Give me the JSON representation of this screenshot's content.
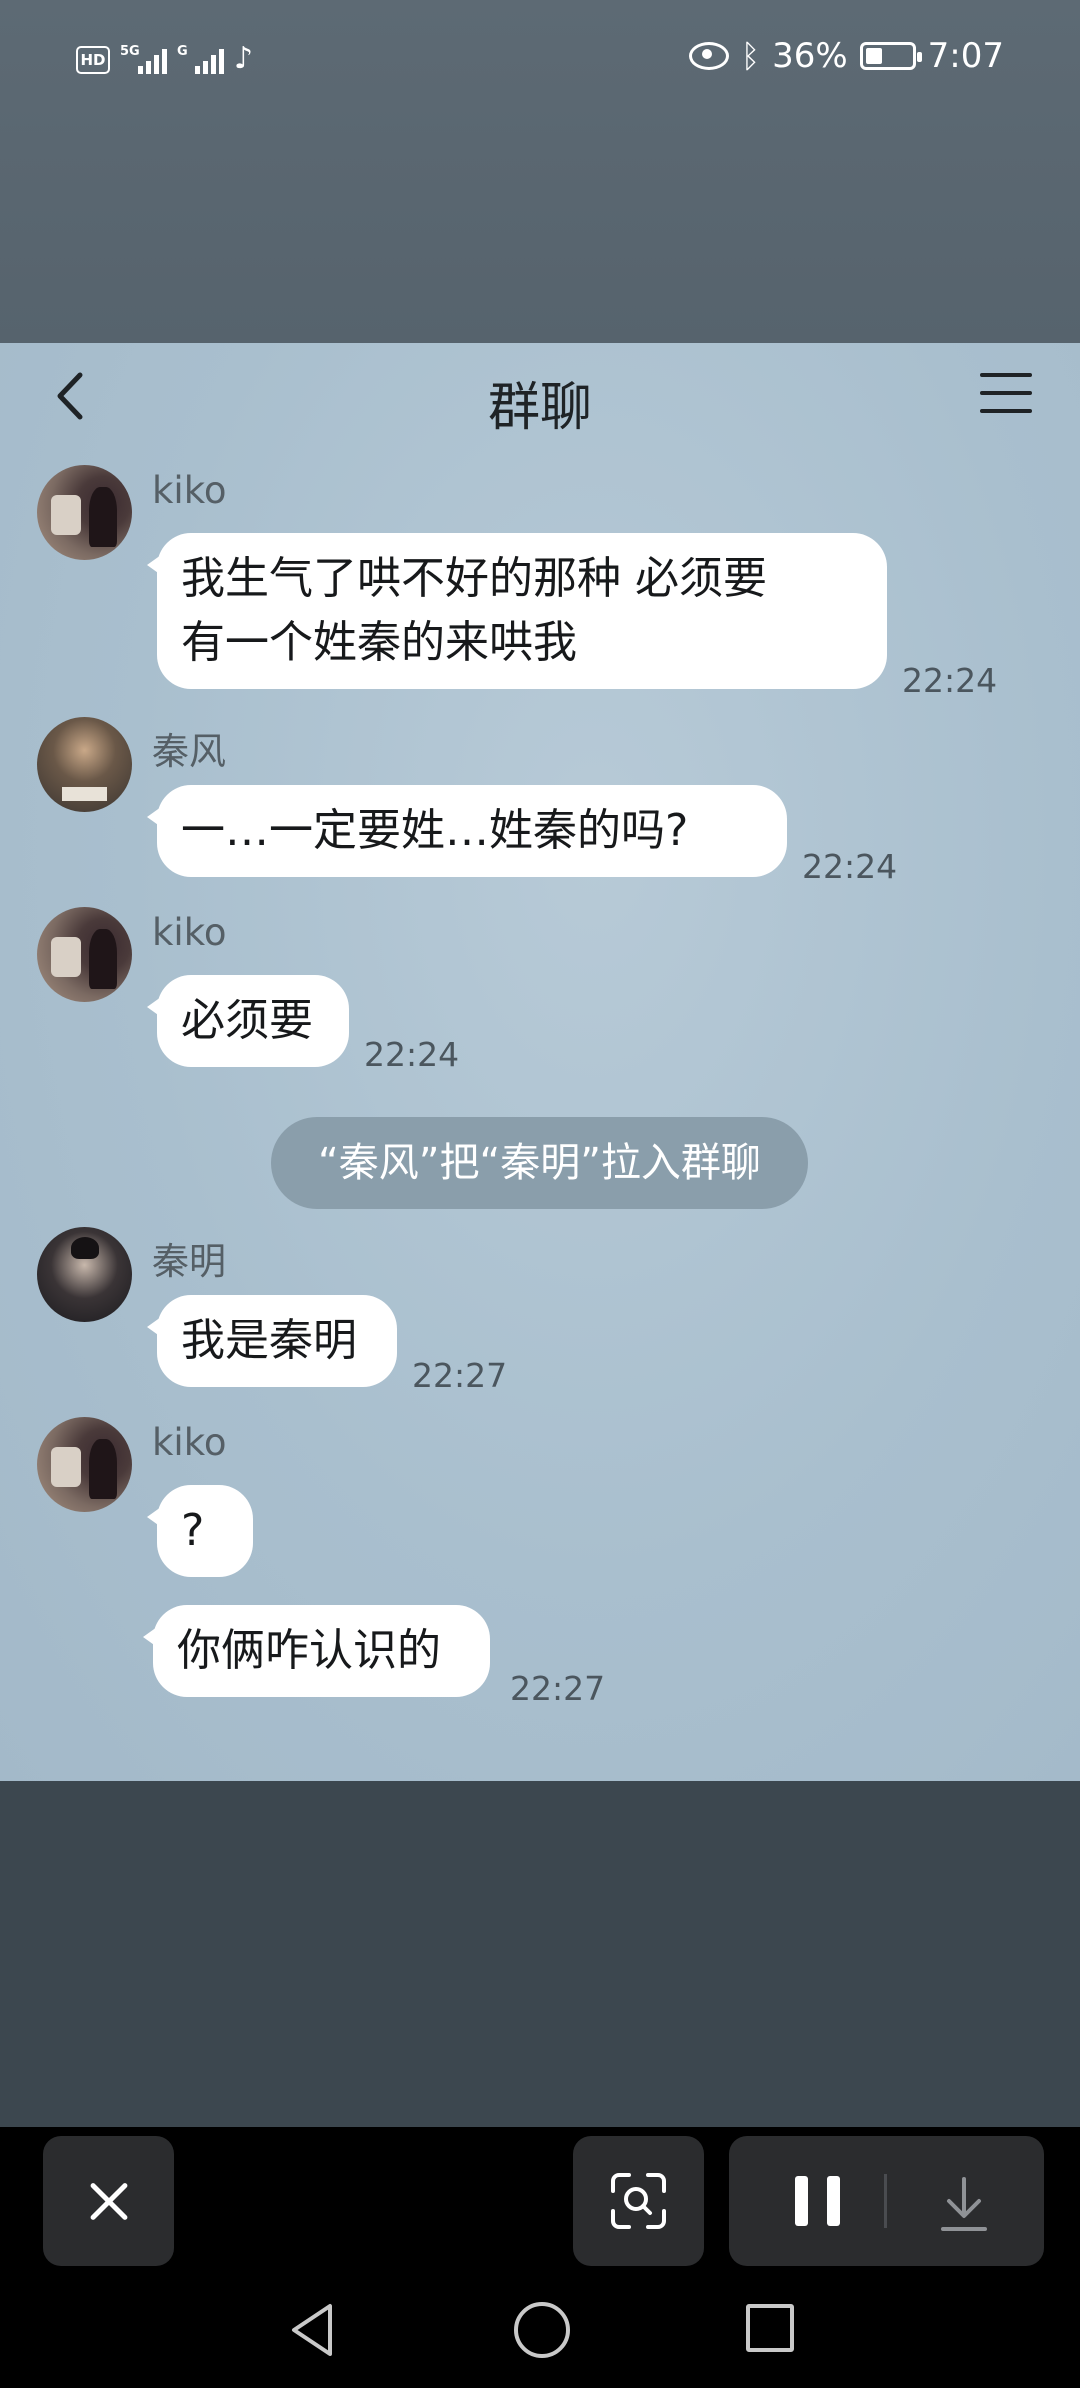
{
  "status_bar": {
    "hd_label": "HD",
    "network1": "5G",
    "network2": "G",
    "battery_percent": "36%",
    "battery_level": 0.36,
    "time": "7:07",
    "icons": [
      "hd-icon",
      "signal-icon",
      "tiktok-icon",
      "eye-icon",
      "bluetooth-icon",
      "battery-icon"
    ]
  },
  "chat": {
    "title": "群聊",
    "back_icon": "chevron-left-icon",
    "menu_icon": "menu-icon",
    "messages": [
      {
        "sender": "kiko",
        "text": "我生气了哄不好的那种 必须要\n有一个姓秦的来哄我",
        "time": "22:24"
      },
      {
        "sender": "秦风",
        "text": "一…一定要姓…姓秦的吗?",
        "time": "22:24"
      },
      {
        "sender": "kiko",
        "text": "必须要",
        "time": "22:24"
      },
      {
        "sender": "秦明",
        "text": "我是秦明",
        "time": "22:27"
      },
      {
        "sender": "kiko",
        "text": "?",
        "time": ""
      },
      {
        "sender": "kiko",
        "text": "你俩咋认识的",
        "time": "22:27"
      }
    ],
    "system_notice": "“秦风”把“秦明”拉入群聊"
  },
  "toolbar": {
    "buttons": [
      "close-icon",
      "scan-icon",
      "pause-icon",
      "download-icon"
    ]
  },
  "navbar": {
    "buttons": [
      "nav-back-icon",
      "nav-home-icon",
      "nav-recents-icon"
    ]
  },
  "colors": {
    "chat_background": "#a9bfce",
    "bubble": "#ffffff",
    "system_notice": "#8a9eab",
    "toolbar_button": "#2b2c2e"
  }
}
